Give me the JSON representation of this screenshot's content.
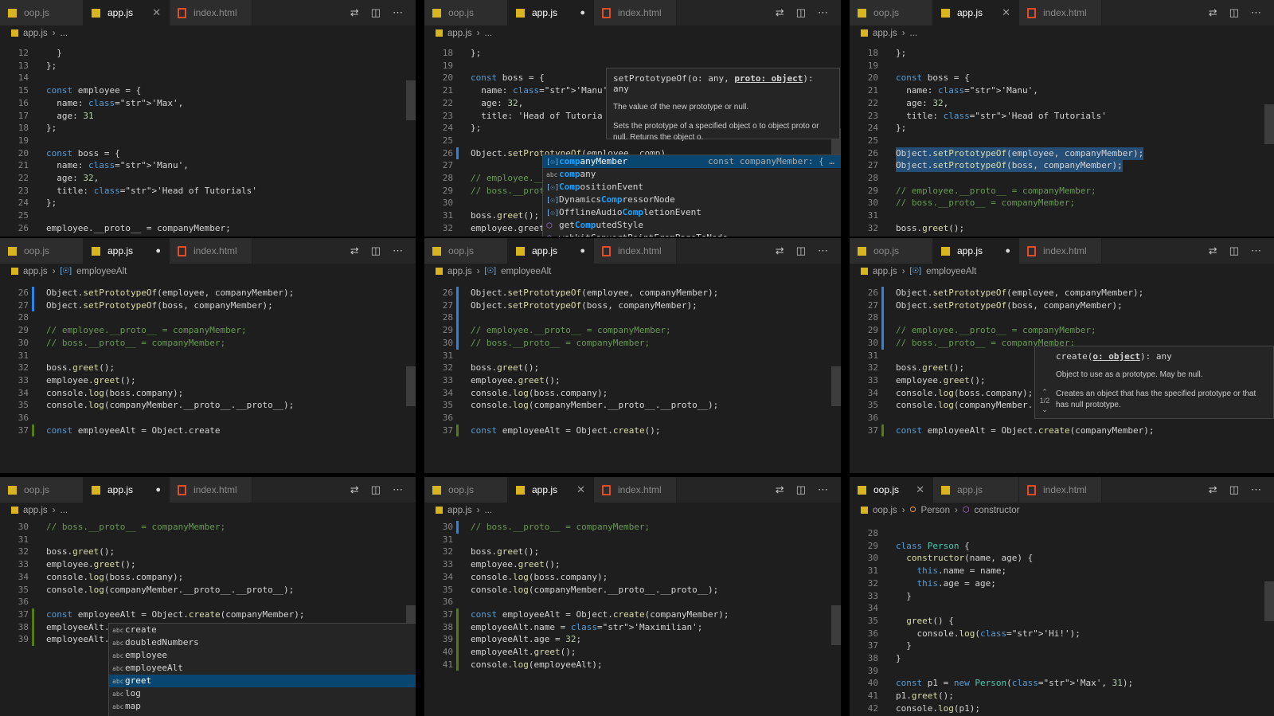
{
  "tabs": {
    "oop": "oop.js",
    "app": "app.js",
    "html": "index.html"
  },
  "breadcrumb": {
    "file_app": "app.js",
    "file_oop": "oop.js",
    "ellipsis": "...",
    "employeeAlt": "employeeAlt",
    "person": "Person",
    "constructor": "constructor"
  },
  "icons": {
    "tab_file_js": "js-file-icon",
    "tab_file_html": "html-file-icon",
    "compare": "compare-changes-icon",
    "split": "split-editor-icon",
    "more": "more-actions-icon",
    "close": "close-icon",
    "dirty": "unsaved-dot-icon"
  },
  "colors": {
    "keyword": "#569cd6",
    "string": "#ce9178",
    "number": "#b5cea8",
    "comment": "#6a9955",
    "selection": "#264f78",
    "js_icon": "#d8b41f",
    "html_icon": "#e44d26"
  },
  "panes": {
    "p1": {
      "lines": [
        {
          "n": "12",
          "t": "  }"
        },
        {
          "n": "13",
          "t": "};"
        },
        {
          "n": "14",
          "t": ""
        },
        {
          "n": "15",
          "t": "const employee = {"
        },
        {
          "n": "16",
          "t": "  name: 'Max',"
        },
        {
          "n": "17",
          "t": "  age: 31"
        },
        {
          "n": "18",
          "t": "};"
        },
        {
          "n": "19",
          "t": ""
        },
        {
          "n": "20",
          "t": "const boss = {"
        },
        {
          "n": "21",
          "t": "  name: 'Manu',"
        },
        {
          "n": "22",
          "t": "  age: 32,"
        },
        {
          "n": "23",
          "t": "  title: 'Head of Tutorials'"
        },
        {
          "n": "24",
          "t": "};"
        },
        {
          "n": "25",
          "t": ""
        },
        {
          "n": "26",
          "t": "employee.__proto__ = companyMember;"
        }
      ]
    },
    "p2": {
      "lines": [
        {
          "n": "18",
          "t": "};"
        },
        {
          "n": "19",
          "t": ""
        },
        {
          "n": "20",
          "t": "const boss = {"
        },
        {
          "n": "21",
          "t": "  name: 'Manu',"
        },
        {
          "n": "22",
          "t": "  age: 32,"
        },
        {
          "n": "23",
          "t": "  title: 'Head of Tutoria"
        },
        {
          "n": "24",
          "t": "};"
        },
        {
          "n": "25",
          "t": ""
        },
        {
          "n": "26",
          "t": "Object.setPrototypeOf(employee, comp)"
        },
        {
          "n": "27",
          "t": ""
        },
        {
          "n": "28",
          "t": "// employee.__"
        },
        {
          "n": "29",
          "t": "// boss.__prot"
        },
        {
          "n": "30",
          "t": ""
        },
        {
          "n": "31",
          "t": "boss.greet();"
        },
        {
          "n": "32",
          "t": "employee.greet"
        },
        {
          "n": "33",
          "t": "console.log(bo"
        }
      ],
      "hover": {
        "sig": "setPrototypeOf(o: any, ",
        "sig_param": "proto: object",
        "sig_end": "): any",
        "p1": "The value of the new prototype or null.",
        "p2": "Sets the prototype of a specified object o to object proto or null. Returns the object o."
      },
      "suggest": [
        {
          "label": "companyMember",
          "detail": "const companyMember: { …",
          "kind": "var"
        },
        {
          "label": "company",
          "kind": "abc"
        },
        {
          "label": "CompositionEvent",
          "kind": "var"
        },
        {
          "label": "DynamicsCompressorNode",
          "kind": "var"
        },
        {
          "label": "OfflineAudioCompletionEvent",
          "kind": "var"
        },
        {
          "label": "getComputedStyle",
          "kind": "fn"
        },
        {
          "label": "webkitConvertPointFromPageToNode",
          "kind": "fn"
        }
      ]
    },
    "p3": {
      "lines": [
        {
          "n": "18",
          "t": "};"
        },
        {
          "n": "19",
          "t": ""
        },
        {
          "n": "20",
          "t": "const boss = {"
        },
        {
          "n": "21",
          "t": "  name: 'Manu',"
        },
        {
          "n": "22",
          "t": "  age: 32,"
        },
        {
          "n": "23",
          "t": "  title: 'Head of Tutorials'"
        },
        {
          "n": "24",
          "t": "};"
        },
        {
          "n": "25",
          "t": ""
        },
        {
          "n": "26",
          "t": "Object.setPrototypeOf(employee, companyMember);"
        },
        {
          "n": "27",
          "t": "Object.setPrototypeOf(boss, companyMember);"
        },
        {
          "n": "28",
          "t": ""
        },
        {
          "n": "29",
          "t": "// employee.__proto__ = companyMember;"
        },
        {
          "n": "30",
          "t": "// boss.__proto__ = companyMember;"
        },
        {
          "n": "31",
          "t": ""
        },
        {
          "n": "32",
          "t": "boss.greet();"
        },
        {
          "n": "33",
          "t": "employee.greet();"
        }
      ]
    },
    "p4": {
      "lines": [
        {
          "n": "26",
          "t": "Object.setPrototypeOf(employee, companyMember);"
        },
        {
          "n": "27",
          "t": "Object.setPrototypeOf(boss, companyMember);"
        },
        {
          "n": "28",
          "t": ""
        },
        {
          "n": "29",
          "t": "// employee.__proto__ = companyMember;"
        },
        {
          "n": "30",
          "t": "// boss.__proto__ = companyMember;"
        },
        {
          "n": "31",
          "t": ""
        },
        {
          "n": "32",
          "t": "boss.greet();"
        },
        {
          "n": "33",
          "t": "employee.greet();"
        },
        {
          "n": "34",
          "t": "console.log(boss.company);"
        },
        {
          "n": "35",
          "t": "console.log(companyMember.__proto__.__proto__);"
        },
        {
          "n": "36",
          "t": ""
        },
        {
          "n": "37",
          "t": "const employeeAlt = Object.create"
        }
      ]
    },
    "p5": {
      "lines": [
        {
          "n": "26",
          "t": "Object.setPrototypeOf(employee, companyMember);"
        },
        {
          "n": "27",
          "t": "Object.setPrototypeOf(boss, companyMember);"
        },
        {
          "n": "28",
          "t": ""
        },
        {
          "n": "29",
          "t": "// employee.__proto__ = companyMember;"
        },
        {
          "n": "30",
          "t": "// boss.__proto__ = companyMember;"
        },
        {
          "n": "31",
          "t": ""
        },
        {
          "n": "32",
          "t": "boss.greet();"
        },
        {
          "n": "33",
          "t": "employee.greet();"
        },
        {
          "n": "34",
          "t": "console.log(boss.company);"
        },
        {
          "n": "35",
          "t": "console.log(companyMember.__proto__.__proto__);"
        },
        {
          "n": "36",
          "t": ""
        },
        {
          "n": "37",
          "t": "const employeeAlt = Object.create();"
        }
      ]
    },
    "p6": {
      "lines": [
        {
          "n": "26",
          "t": "Object.setPrototypeOf(employee, companyMember);"
        },
        {
          "n": "27",
          "t": "Object.setPrototypeOf(boss, companyMember);"
        },
        {
          "n": "28",
          "t": ""
        },
        {
          "n": "29",
          "t": "// employee.__proto__ = companyMember;"
        },
        {
          "n": "30",
          "t": "// boss.__proto__ = companyMember;"
        },
        {
          "n": "31",
          "t": ""
        },
        {
          "n": "32",
          "t": "boss.greet();"
        },
        {
          "n": "33",
          "t": "employee.greet();"
        },
        {
          "n": "34",
          "t": "console.log(boss.company);"
        },
        {
          "n": "35",
          "t": "console.log(companyMember."
        },
        {
          "n": "36",
          "t": ""
        },
        {
          "n": "37",
          "t": "const employeeAlt = Object.create(companyMember);"
        }
      ],
      "hover": {
        "sig": "create(",
        "sig_param": "o: object",
        "sig_end": "): any",
        "p1": "Object to use as a prototype. May be null.",
        "p2": "Creates an object that has the specified prototype or that has null prototype.",
        "counter": "1/2"
      }
    },
    "p7": {
      "lines": [
        {
          "n": "30",
          "t": "// boss.__proto__ = companyMember;"
        },
        {
          "n": "31",
          "t": ""
        },
        {
          "n": "32",
          "t": "boss.greet();"
        },
        {
          "n": "33",
          "t": "employee.greet();"
        },
        {
          "n": "34",
          "t": "console.log(boss.company);"
        },
        {
          "n": "35",
          "t": "console.log(companyMember.__proto__.__proto__);"
        },
        {
          "n": "36",
          "t": ""
        },
        {
          "n": "37",
          "t": "const employeeAlt = Object.create(companyMember);"
        },
        {
          "n": "38",
          "t": "employeeAlt."
        },
        {
          "n": "39",
          "t": "employeeAlt."
        }
      ],
      "suggest": [
        {
          "label": "create"
        },
        {
          "label": "doubledNumbers"
        },
        {
          "label": "employee"
        },
        {
          "label": "employeeAlt"
        },
        {
          "label": "greet"
        },
        {
          "label": "log"
        },
        {
          "label": "map"
        }
      ]
    },
    "p8": {
      "lines": [
        {
          "n": "30",
          "t": "// boss.__proto__ = companyMember;"
        },
        {
          "n": "31",
          "t": ""
        },
        {
          "n": "32",
          "t": "boss.greet();"
        },
        {
          "n": "33",
          "t": "employee.greet();"
        },
        {
          "n": "34",
          "t": "console.log(boss.company);"
        },
        {
          "n": "35",
          "t": "console.log(companyMember.__proto__.__proto__);"
        },
        {
          "n": "36",
          "t": ""
        },
        {
          "n": "37",
          "t": "const employeeAlt = Object.create(companyMember);"
        },
        {
          "n": "38",
          "t": "employeeAlt.name = 'Maximilian';"
        },
        {
          "n": "39",
          "t": "employeeAlt.age = 32;"
        },
        {
          "n": "40",
          "t": "employeeAlt.greet();"
        },
        {
          "n": "41",
          "t": "console.log(employeeAlt);"
        }
      ]
    },
    "p9": {
      "lines": [
        {
          "n": "28",
          "t": ""
        },
        {
          "n": "29",
          "t": "class Person {"
        },
        {
          "n": "30",
          "t": "  constructor(name, age) {"
        },
        {
          "n": "31",
          "t": "    this.name = name;"
        },
        {
          "n": "32",
          "t": "    this.age = age;"
        },
        {
          "n": "33",
          "t": "  }"
        },
        {
          "n": "34",
          "t": ""
        },
        {
          "n": "35",
          "t": "  greet() {"
        },
        {
          "n": "36",
          "t": "    console.log('Hi!');"
        },
        {
          "n": "37",
          "t": "  }"
        },
        {
          "n": "38",
          "t": "}"
        },
        {
          "n": "39",
          "t": ""
        },
        {
          "n": "40",
          "t": "const p1 = new Person('Max', 31);"
        },
        {
          "n": "41",
          "t": "p1.greet();"
        },
        {
          "n": "42",
          "t": "console.log(p1);"
        }
      ]
    }
  }
}
